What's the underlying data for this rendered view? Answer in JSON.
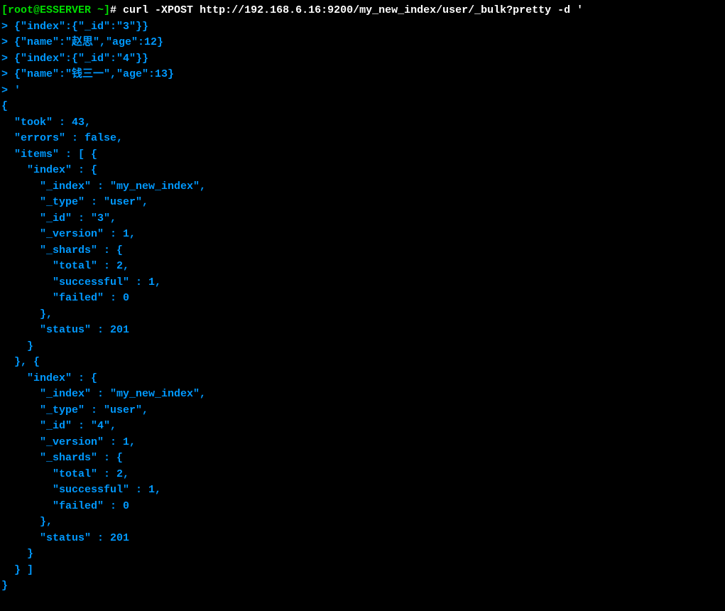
{
  "prompt": {
    "user_host": "[root@ESSERVER ~]",
    "command": "curl -XPOST http://192.168.6.16:9200/my_new_index/user/_bulk?pretty -d '"
  },
  "input_lines": [
    "> {\"index\":{\"_id\":\"3\"}}",
    "> {\"name\":\"赵思\",\"age\":12}",
    "> {\"index\":{\"_id\":\"4\"}}",
    "> {\"name\":\"钱三一\",\"age\":13}",
    "> '"
  ],
  "response_lines": [
    "{",
    "  \"took\" : 43,",
    "  \"errors\" : false,",
    "  \"items\" : [ {",
    "    \"index\" : {",
    "      \"_index\" : \"my_new_index\",",
    "      \"_type\" : \"user\",",
    "      \"_id\" : \"3\",",
    "      \"_version\" : 1,",
    "      \"_shards\" : {",
    "        \"total\" : 2,",
    "        \"successful\" : 1,",
    "        \"failed\" : 0",
    "      },",
    "      \"status\" : 201",
    "    }",
    "  }, {",
    "    \"index\" : {",
    "      \"_index\" : \"my_new_index\",",
    "      \"_type\" : \"user\",",
    "      \"_id\" : \"4\",",
    "      \"_version\" : 1,",
    "      \"_shards\" : {",
    "        \"total\" : 2,",
    "        \"successful\" : 1,",
    "        \"failed\" : 0",
    "      },",
    "      \"status\" : 201",
    "    }",
    "  } ]",
    "}"
  ]
}
